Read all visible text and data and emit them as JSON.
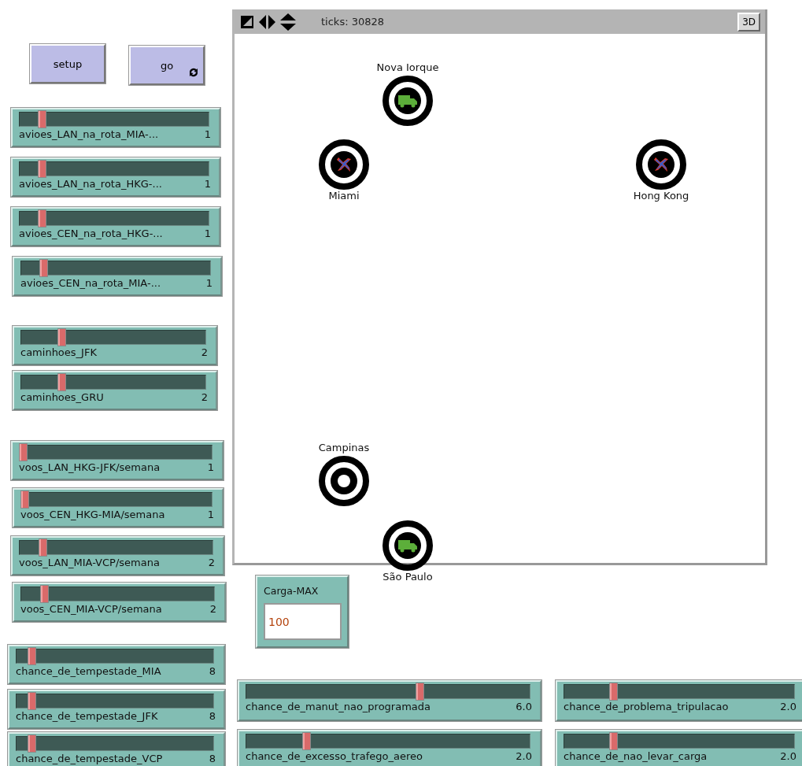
{
  "buttons": [
    {
      "label": "setup",
      "forever": false
    },
    {
      "label": "go",
      "forever": true
    }
  ],
  "view": {
    "ticks": "ticks: 30828",
    "button_3d": "3D",
    "turtles": [
      {
        "label": "Nova Iorque",
        "kind": "truck"
      },
      {
        "label": "Miami",
        "kind": "plane"
      },
      {
        "label": "Hong Kong",
        "kind": "plane"
      },
      {
        "label": "Campinas",
        "kind": "empty"
      },
      {
        "label": "São Paulo",
        "kind": "truck"
      }
    ]
  },
  "sliders": [
    {
      "label": "avioes_LAN_na_rota_MIA-...",
      "value": "1",
      "level": 0.1
    },
    {
      "label": "avioes_LAN_na_rota_HKG-...",
      "value": "1",
      "level": 0.1
    },
    {
      "label": "avioes_CEN_na_rota_HKG-...",
      "value": "1",
      "level": 0.1
    },
    {
      "label": "avioes_CEN_na_rota_MIA-...",
      "value": "1",
      "level": 0.1
    },
    {
      "label": "caminhoes_JFK",
      "value": "2",
      "level": 0.2
    },
    {
      "label": "caminhoes_GRU",
      "value": "2",
      "level": 0.2
    },
    {
      "label": "voos_LAN_HKG-JFK/semana",
      "value": "1",
      "level": 0
    },
    {
      "label": "voos_CEN_HKG-MIA/semana",
      "value": "1",
      "level": 0
    },
    {
      "label": "voos_LAN_MIA-VCP/semana",
      "value": "2",
      "level": 0.1
    },
    {
      "label": "voos_CEN_MIA-VCP/semana",
      "value": "2",
      "level": 0.1
    },
    {
      "label": "chance_de_tempestade_MIA",
      "value": "8",
      "level": 0.06
    },
    {
      "label": "chance_de_tempestade_JFK",
      "value": "8",
      "level": 0.06
    },
    {
      "label": "chance_de_tempestade_VCP",
      "value": "8",
      "level": 0.06
    },
    {
      "label": "chance_de_manut_nao_programada",
      "value": "6.0",
      "level": 0.6
    },
    {
      "label": "chance_de_excesso_trafego_aereo",
      "value": "2.0",
      "level": 0.2
    },
    {
      "label": "chance_de_problema_tripulacao",
      "value": "2.0",
      "level": 0.2
    },
    {
      "label": "chance_de_nao_levar_carga",
      "value": "2.0",
      "level": 0.2
    }
  ],
  "input": {
    "label": "Carga-MAX",
    "value": "100"
  }
}
